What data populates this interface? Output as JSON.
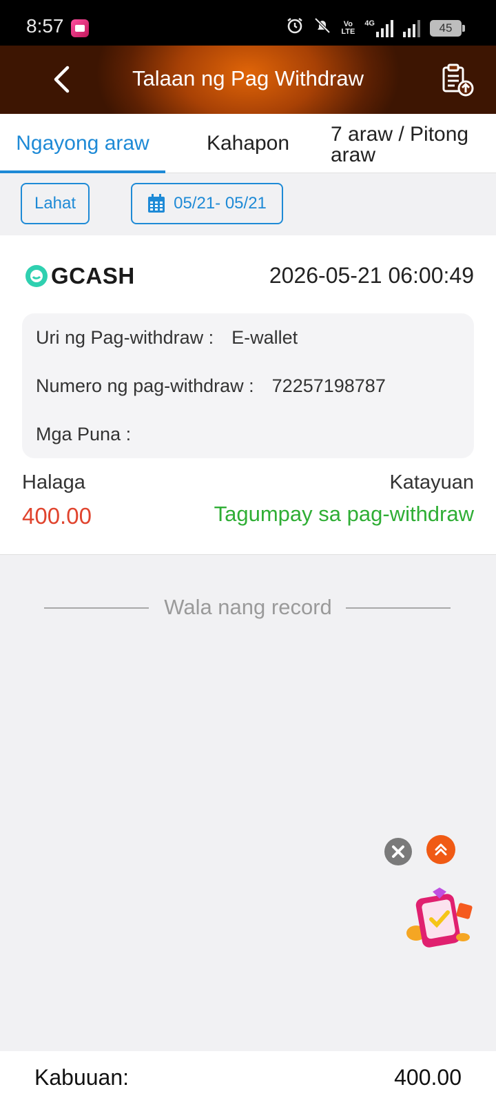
{
  "status_bar": {
    "time": "8:57",
    "network_label": "4G",
    "volte_line1": "Vo",
    "volte_line2": "LTE",
    "battery": "45"
  },
  "header": {
    "title": "Talaan ng Pag Withdraw",
    "back_icon": "chevron-left-icon",
    "action_icon": "clipboard-upload-icon"
  },
  "tabs": [
    {
      "label": "Ngayong araw",
      "active": true
    },
    {
      "label": "Kahapon",
      "active": false
    },
    {
      "label": "7 araw / Pitong araw",
      "active": false
    }
  ],
  "filters": {
    "all_label": "Lahat",
    "date_range": "05/21- 05/21"
  },
  "record": {
    "method": "GCASH",
    "datetime": "2026-05-21 06:00:49",
    "type_label": "Uri ng Pag-withdraw :",
    "type_value": "E-wallet",
    "number_label": "Numero ng pag-withdraw :",
    "number_value": "72257198787",
    "remarks_label": "Mga Puna :",
    "remarks_value": "",
    "amount_label": "Halaga",
    "amount_value": "400.00",
    "status_label": "Katayuan",
    "status_value": "Tagumpay sa pag-withdraw"
  },
  "no_more_text": "Wala nang record",
  "footer": {
    "total_label": "Kabuuan:",
    "total_value": "400.00"
  },
  "colors": {
    "accent_blue": "#1e8ad6",
    "amount_red": "#e0442e",
    "success_green": "#2fae35",
    "header_orange": "#e06508"
  }
}
